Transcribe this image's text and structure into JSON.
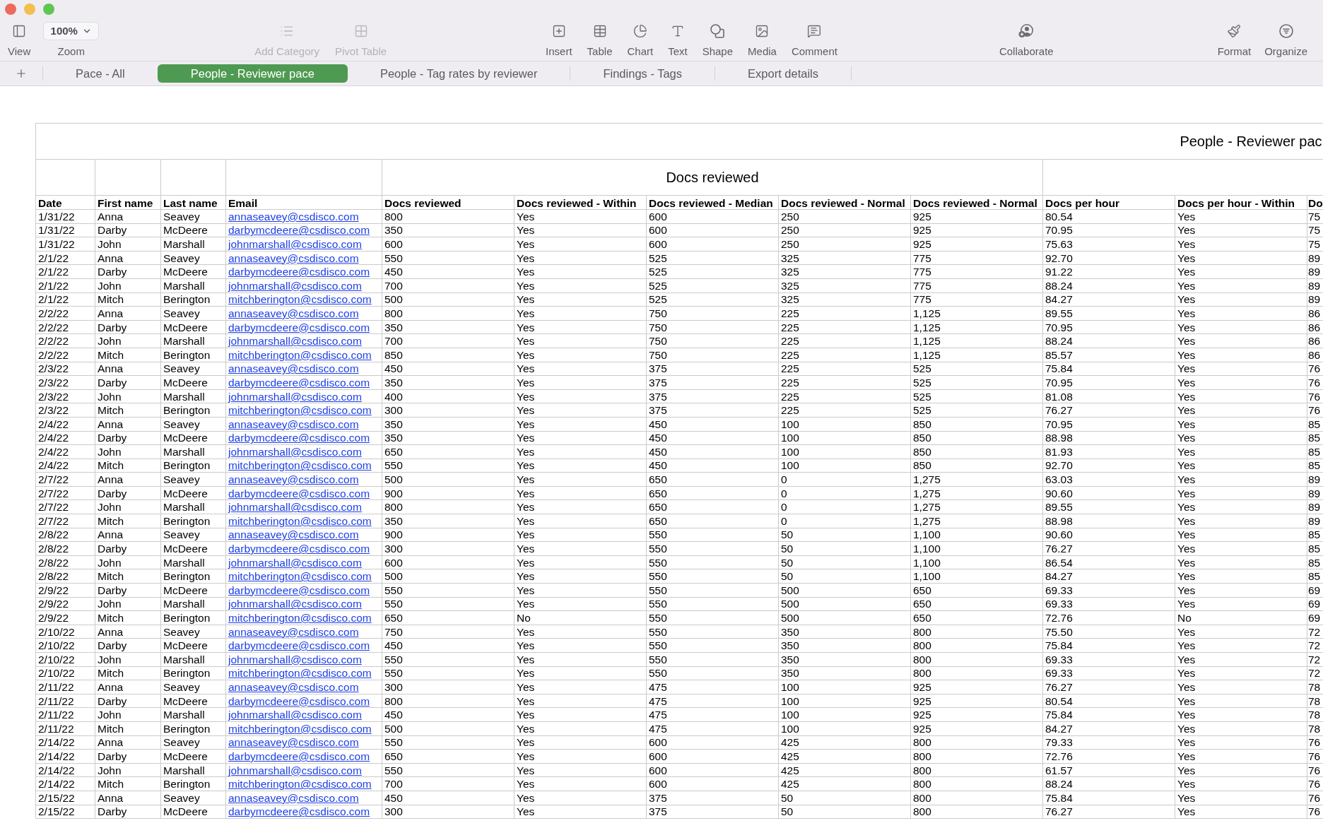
{
  "toolbar": {
    "groups": [
      {
        "items": [
          {
            "kind": "button",
            "label": "View",
            "disabled": false
          },
          {
            "kind": "dropdown",
            "label": "Zoom",
            "value": "100%",
            "disabled": false
          }
        ]
      },
      {
        "items": [
          {
            "kind": "button",
            "label": "Add Category",
            "disabled": true
          },
          {
            "kind": "button",
            "label": "Pivot Table",
            "disabled": true
          }
        ]
      },
      {
        "items": [
          {
            "kind": "button",
            "label": "Insert",
            "disabled": false
          },
          {
            "kind": "button",
            "label": "Table",
            "disabled": false
          },
          {
            "kind": "button",
            "label": "Chart",
            "disabled": false
          },
          {
            "kind": "button",
            "label": "Text",
            "disabled": false
          },
          {
            "kind": "button",
            "label": "Shape",
            "disabled": false
          },
          {
            "kind": "button",
            "label": "Media",
            "disabled": false
          },
          {
            "kind": "button",
            "label": "Comment",
            "disabled": false
          }
        ]
      },
      {
        "items": [
          {
            "kind": "button",
            "label": "Collaborate",
            "disabled": false
          }
        ]
      },
      {
        "items": [
          {
            "kind": "button",
            "label": "Format",
            "disabled": false
          },
          {
            "kind": "button",
            "label": "Organize",
            "disabled": false
          }
        ]
      }
    ]
  },
  "sheet_tabs": [
    {
      "label": "Pace - All",
      "selected": false
    },
    {
      "label": "People - Reviewer pace",
      "selected": true
    },
    {
      "label": "People - Tag rates by reviewer",
      "selected": false
    },
    {
      "label": "Findings - Tags",
      "selected": false
    },
    {
      "label": "Export details",
      "selected": false
    }
  ],
  "table": {
    "title": "People - Reviewer pac",
    "header_groups": [
      {
        "columns": [
          {
            "label": "Date",
            "kind": "text"
          }
        ]
      },
      {
        "columns": [
          {
            "label": "First name",
            "kind": "text"
          }
        ]
      },
      {
        "columns": [
          {
            "label": "Last name",
            "kind": "text"
          }
        ]
      },
      {
        "columns": [
          {
            "label": "Email",
            "kind": "link"
          }
        ]
      },
      {
        "label": "Docs reviewed",
        "columns": [
          {
            "label": "Docs reviewed",
            "kind": "text"
          },
          {
            "label": "Docs reviewed - Within",
            "kind": "text"
          },
          {
            "label": "Docs reviewed - Median",
            "kind": "text"
          },
          {
            "label": "Docs reviewed - Normal",
            "kind": "text"
          },
          {
            "label": "Docs reviewed - Normal",
            "kind": "text"
          }
        ]
      },
      {
        "columns": [
          {
            "label": "Docs per hour",
            "kind": "text"
          },
          {
            "label": "Docs per hour - Within",
            "kind": "text"
          },
          {
            "label": "Do",
            "kind": "text"
          }
        ]
      }
    ],
    "rows": [
      [
        "1/31/22",
        "Anna",
        "Seavey",
        "annaseavey@csdisco.com",
        "800",
        "Yes",
        "600",
        "250",
        "925",
        "80.54",
        "Yes",
        "75"
      ],
      [
        "1/31/22",
        "Darby",
        "McDeere",
        "darbymcdeere@csdisco.com",
        "350",
        "Yes",
        "600",
        "250",
        "925",
        "70.95",
        "Yes",
        "75"
      ],
      [
        "1/31/22",
        "John",
        "Marshall",
        "johnmarshall@csdisco.com",
        "600",
        "Yes",
        "600",
        "250",
        "925",
        "75.63",
        "Yes",
        "75"
      ],
      [
        "2/1/22",
        "Anna",
        "Seavey",
        "annaseavey@csdisco.com",
        "550",
        "Yes",
        "525",
        "325",
        "775",
        "92.70",
        "Yes",
        "89"
      ],
      [
        "2/1/22",
        "Darby",
        "McDeere",
        "darbymcdeere@csdisco.com",
        "450",
        "Yes",
        "525",
        "325",
        "775",
        "91.22",
        "Yes",
        "89"
      ],
      [
        "2/1/22",
        "John",
        "Marshall",
        "johnmarshall@csdisco.com",
        "700",
        "Yes",
        "525",
        "325",
        "775",
        "88.24",
        "Yes",
        "89"
      ],
      [
        "2/1/22",
        "Mitch",
        "Berington",
        "mitchberington@csdisco.com",
        "500",
        "Yes",
        "525",
        "325",
        "775",
        "84.27",
        "Yes",
        "89"
      ],
      [
        "2/2/22",
        "Anna",
        "Seavey",
        "annaseavey@csdisco.com",
        "800",
        "Yes",
        "750",
        "225",
        "1,125",
        "89.55",
        "Yes",
        "86"
      ],
      [
        "2/2/22",
        "Darby",
        "McDeere",
        "darbymcdeere@csdisco.com",
        "350",
        "Yes",
        "750",
        "225",
        "1,125",
        "70.95",
        "Yes",
        "86"
      ],
      [
        "2/2/22",
        "John",
        "Marshall",
        "johnmarshall@csdisco.com",
        "700",
        "Yes",
        "750",
        "225",
        "1,125",
        "88.24",
        "Yes",
        "86"
      ],
      [
        "2/2/22",
        "Mitch",
        "Berington",
        "mitchberington@csdisco.com",
        "850",
        "Yes",
        "750",
        "225",
        "1,125",
        "85.57",
        "Yes",
        "86"
      ],
      [
        "2/3/22",
        "Anna",
        "Seavey",
        "annaseavey@csdisco.com",
        "450",
        "Yes",
        "375",
        "225",
        "525",
        "75.84",
        "Yes",
        "76"
      ],
      [
        "2/3/22",
        "Darby",
        "McDeere",
        "darbymcdeere@csdisco.com",
        "350",
        "Yes",
        "375",
        "225",
        "525",
        "70.95",
        "Yes",
        "76"
      ],
      [
        "2/3/22",
        "John",
        "Marshall",
        "johnmarshall@csdisco.com",
        "400",
        "Yes",
        "375",
        "225",
        "525",
        "81.08",
        "Yes",
        "76"
      ],
      [
        "2/3/22",
        "Mitch",
        "Berington",
        "mitchberington@csdisco.com",
        "300",
        "Yes",
        "375",
        "225",
        "525",
        "76.27",
        "Yes",
        "76"
      ],
      [
        "2/4/22",
        "Anna",
        "Seavey",
        "annaseavey@csdisco.com",
        "350",
        "Yes",
        "450",
        "100",
        "850",
        "70.95",
        "Yes",
        "85"
      ],
      [
        "2/4/22",
        "Darby",
        "McDeere",
        "darbymcdeere@csdisco.com",
        "350",
        "Yes",
        "450",
        "100",
        "850",
        "88.98",
        "Yes",
        "85"
      ],
      [
        "2/4/22",
        "John",
        "Marshall",
        "johnmarshall@csdisco.com",
        "650",
        "Yes",
        "450",
        "100",
        "850",
        "81.93",
        "Yes",
        "85"
      ],
      [
        "2/4/22",
        "Mitch",
        "Berington",
        "mitchberington@csdisco.com",
        "550",
        "Yes",
        "450",
        "100",
        "850",
        "92.70",
        "Yes",
        "85"
      ],
      [
        "2/7/22",
        "Anna",
        "Seavey",
        "annaseavey@csdisco.com",
        "500",
        "Yes",
        "650",
        "0",
        "1,275",
        "63.03",
        "Yes",
        "89"
      ],
      [
        "2/7/22",
        "Darby",
        "McDeere",
        "darbymcdeere@csdisco.com",
        "900",
        "Yes",
        "650",
        "0",
        "1,275",
        "90.60",
        "Yes",
        "89"
      ],
      [
        "2/7/22",
        "John",
        "Marshall",
        "johnmarshall@csdisco.com",
        "800",
        "Yes",
        "650",
        "0",
        "1,275",
        "89.55",
        "Yes",
        "89"
      ],
      [
        "2/7/22",
        "Mitch",
        "Berington",
        "mitchberington@csdisco.com",
        "350",
        "Yes",
        "650",
        "0",
        "1,275",
        "88.98",
        "Yes",
        "89"
      ],
      [
        "2/8/22",
        "Anna",
        "Seavey",
        "annaseavey@csdisco.com",
        "900",
        "Yes",
        "550",
        "50",
        "1,100",
        "90.60",
        "Yes",
        "85"
      ],
      [
        "2/8/22",
        "Darby",
        "McDeere",
        "darbymcdeere@csdisco.com",
        "300",
        "Yes",
        "550",
        "50",
        "1,100",
        "76.27",
        "Yes",
        "85"
      ],
      [
        "2/8/22",
        "John",
        "Marshall",
        "johnmarshall@csdisco.com",
        "600",
        "Yes",
        "550",
        "50",
        "1,100",
        "86.54",
        "Yes",
        "85"
      ],
      [
        "2/8/22",
        "Mitch",
        "Berington",
        "mitchberington@csdisco.com",
        "500",
        "Yes",
        "550",
        "50",
        "1,100",
        "84.27",
        "Yes",
        "85"
      ],
      [
        "2/9/22",
        "Darby",
        "McDeere",
        "darbymcdeere@csdisco.com",
        "550",
        "Yes",
        "550",
        "500",
        "650",
        "69.33",
        "Yes",
        "69"
      ],
      [
        "2/9/22",
        "John",
        "Marshall",
        "johnmarshall@csdisco.com",
        "550",
        "Yes",
        "550",
        "500",
        "650",
        "69.33",
        "Yes",
        "69"
      ],
      [
        "2/9/22",
        "Mitch",
        "Berington",
        "mitchberington@csdisco.com",
        "650",
        "No",
        "550",
        "500",
        "650",
        "72.76",
        "No",
        "69"
      ],
      [
        "2/10/22",
        "Anna",
        "Seavey",
        "annaseavey@csdisco.com",
        "750",
        "Yes",
        "550",
        "350",
        "800",
        "75.50",
        "Yes",
        "72"
      ],
      [
        "2/10/22",
        "Darby",
        "McDeere",
        "darbymcdeere@csdisco.com",
        "450",
        "Yes",
        "550",
        "350",
        "800",
        "75.84",
        "Yes",
        "72"
      ],
      [
        "2/10/22",
        "John",
        "Marshall",
        "johnmarshall@csdisco.com",
        "550",
        "Yes",
        "550",
        "350",
        "800",
        "69.33",
        "Yes",
        "72"
      ],
      [
        "2/10/22",
        "Mitch",
        "Berington",
        "mitchberington@csdisco.com",
        "550",
        "Yes",
        "550",
        "350",
        "800",
        "69.33",
        "Yes",
        "72"
      ],
      [
        "2/11/22",
        "Anna",
        "Seavey",
        "annaseavey@csdisco.com",
        "300",
        "Yes",
        "475",
        "100",
        "925",
        "76.27",
        "Yes",
        "78"
      ],
      [
        "2/11/22",
        "Darby",
        "McDeere",
        "darbymcdeere@csdisco.com",
        "800",
        "Yes",
        "475",
        "100",
        "925",
        "80.54",
        "Yes",
        "78"
      ],
      [
        "2/11/22",
        "John",
        "Marshall",
        "johnmarshall@csdisco.com",
        "450",
        "Yes",
        "475",
        "100",
        "925",
        "75.84",
        "Yes",
        "78"
      ],
      [
        "2/11/22",
        "Mitch",
        "Berington",
        "mitchberington@csdisco.com",
        "500",
        "Yes",
        "475",
        "100",
        "925",
        "84.27",
        "Yes",
        "78"
      ],
      [
        "2/14/22",
        "Anna",
        "Seavey",
        "annaseavey@csdisco.com",
        "550",
        "Yes",
        "600",
        "425",
        "800",
        "79.33",
        "Yes",
        "76"
      ],
      [
        "2/14/22",
        "Darby",
        "McDeere",
        "darbymcdeere@csdisco.com",
        "650",
        "Yes",
        "600",
        "425",
        "800",
        "72.76",
        "Yes",
        "76"
      ],
      [
        "2/14/22",
        "John",
        "Marshall",
        "johnmarshall@csdisco.com",
        "550",
        "Yes",
        "600",
        "425",
        "800",
        "61.57",
        "Yes",
        "76"
      ],
      [
        "2/14/22",
        "Mitch",
        "Berington",
        "mitchberington@csdisco.com",
        "700",
        "Yes",
        "600",
        "425",
        "800",
        "88.24",
        "Yes",
        "76"
      ],
      [
        "2/15/22",
        "Anna",
        "Seavey",
        "annaseavey@csdisco.com",
        "450",
        "Yes",
        "375",
        "50",
        "800",
        "75.84",
        "Yes",
        "76"
      ],
      [
        "2/15/22",
        "Darby",
        "McDeere",
        "darbymcdeere@csdisco.com",
        "300",
        "Yes",
        "375",
        "50",
        "800",
        "76.27",
        "Yes",
        "76"
      ]
    ]
  }
}
